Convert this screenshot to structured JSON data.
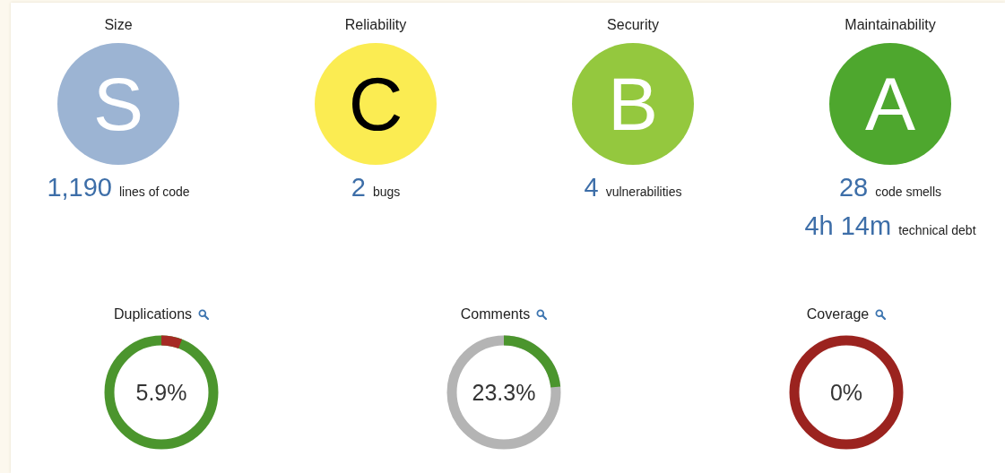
{
  "ratings": [
    {
      "title": "Size",
      "grade": "S",
      "color": "#9cb4d3",
      "measures": [
        {
          "value": "1,190",
          "label": "lines of code"
        }
      ]
    },
    {
      "title": "Reliability",
      "grade": "C",
      "color": "#fbec52",
      "measures": [
        {
          "value": "2",
          "label": "bugs"
        }
      ]
    },
    {
      "title": "Security",
      "grade": "B",
      "color": "#94c83e",
      "measures": [
        {
          "value": "4",
          "label": "vulnerabilities"
        }
      ]
    },
    {
      "title": "Maintainability",
      "grade": "A",
      "color": "#4ea72e",
      "measures": [
        {
          "value": "28",
          "label": "code smells"
        },
        {
          "value": "4h 14m",
          "label": "technical debt"
        }
      ]
    }
  ],
  "donuts": [
    {
      "title": "Duplications",
      "value": "5.9%",
      "kind": "bad-share"
    },
    {
      "title": "Comments",
      "value": "23.3%",
      "kind": "good-share"
    },
    {
      "title": "Coverage",
      "value": "0%",
      "kind": "good-over-bad"
    }
  ]
}
